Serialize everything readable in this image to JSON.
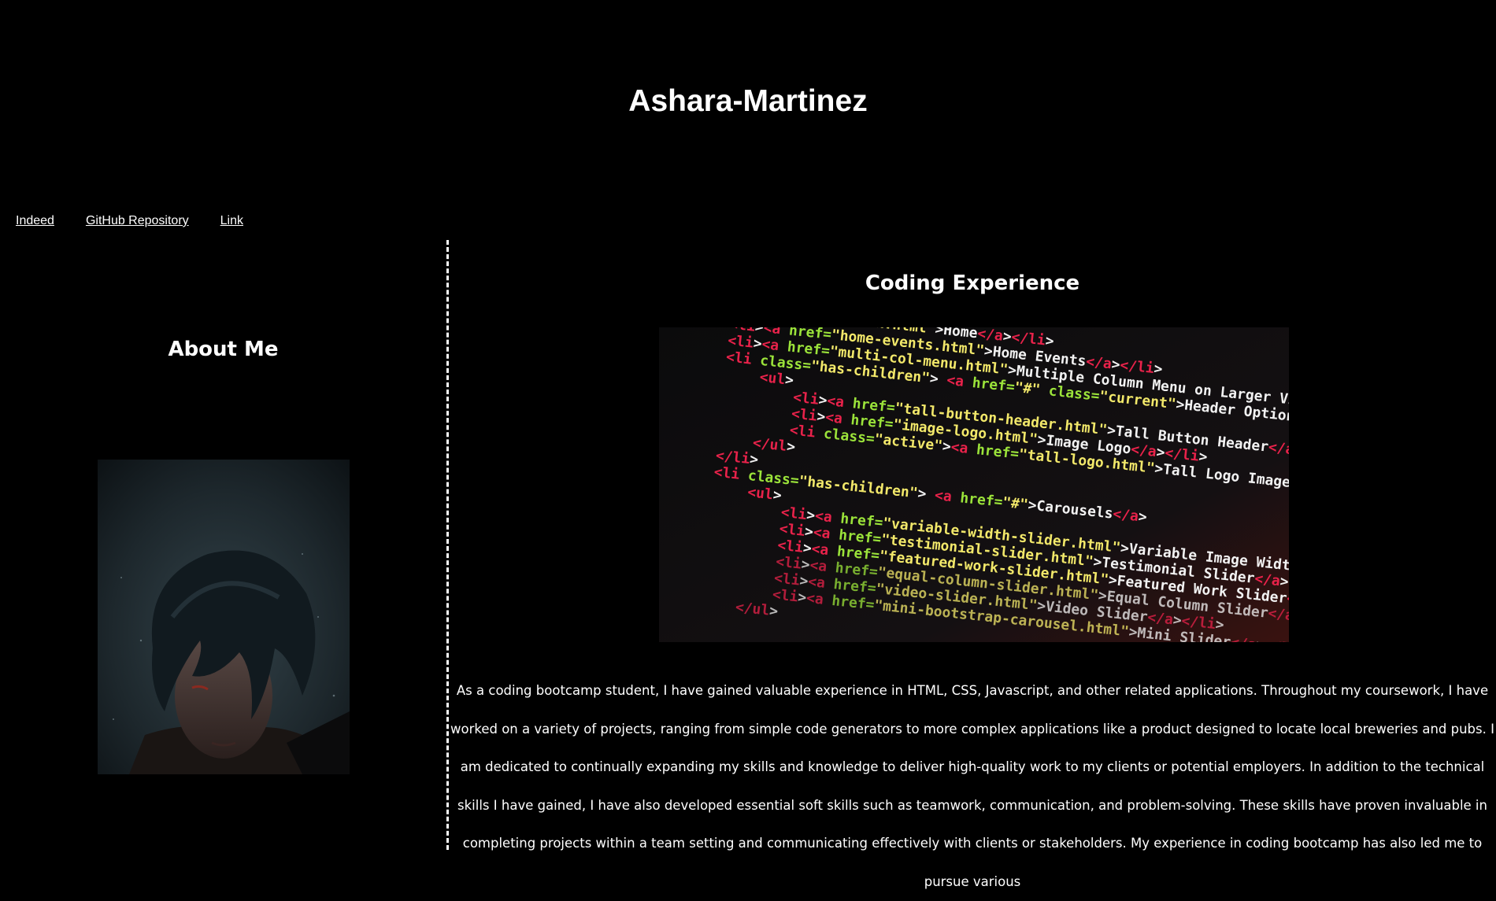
{
  "header": {
    "title": "Ashara-Martinez"
  },
  "nav": {
    "links": [
      {
        "label": "Indeed"
      },
      {
        "label": "GitHub Repository"
      },
      {
        "label": "Link"
      }
    ]
  },
  "about": {
    "title": "About Me",
    "portrait_icon": "portrait-image"
  },
  "experience": {
    "title": "Coding Experience",
    "image_icon": "code-screenshot-image",
    "paragraph": "As a coding bootcamp student, I have gained valuable experience in HTML, CSS, Javascript, and other related applications. Throughout my coursework, I have worked on a variety of projects, ranging from simple code generators to more complex applications like a product designed to locate local breweries and pubs. I am dedicated to continually expanding my skills and knowledge to deliver high-quality work to my clients or potential employers. In addition to the technical skills I have gained, I have also developed essential soft skills such as teamwork, communication, and problem-solving. These skills have proven invaluable in completing projects within a team setting and communicating effectively with clients or stakeholders. My experience in coding bootcamp has also led me to pursue various"
  },
  "code_lines": [
    "<li><a href=\"index.html\">Home</a></li>",
    "<li><a href=\"home-events.html\">Home Events</a></li>",
    "<li><a href=\"multi-col-menu.html\">Multiple Column Menu on Larger Viewports</a></li>",
    "<li class=\"has-children\"> <a href=\"#\" class=\"current\">Header Options</a>",
    "<ul>",
    "<li><a href=\"tall-button-header.html\">Tall Button Header</a></li>",
    "<li><a href=\"image-logo.html\">Image Logo</a></li>",
    "<li class=\"active\"><a href=\"tall-logo.html\">Tall Logo Image</a></li>",
    "</ul>",
    "</li>",
    "<li class=\"has-children\"> <a href=\"#\">Carousels</a>",
    "<ul>",
    "<li><a href=\"variable-width-slider.html\">Variable Image Width</a></li>",
    "<li><a href=\"testimonial-slider.html\">Testimonial Slider</a></li>",
    "<li><a href=\"featured-work-slider.html\">Featured Work Slider</a></li>",
    "<li><a href=\"equal-column-slider.html\">Equal Column Slider</a></li>",
    "<li><a href=\"video-slider.html\">Video Slider</a></li>",
    "<li><a href=\"mini-bootstrap-carousel.html\">Mini Slider</a></li>",
    "</ul>"
  ]
}
